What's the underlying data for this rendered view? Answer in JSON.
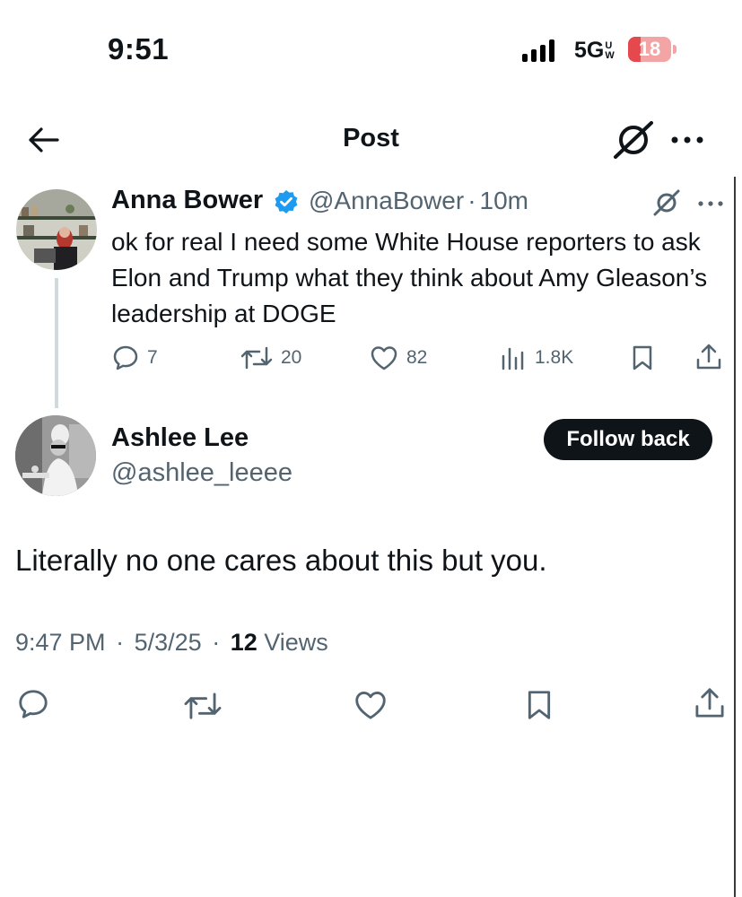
{
  "status_bar": {
    "time": "9:51",
    "network": "5G",
    "network_sup": "U",
    "network_sub": "W",
    "battery": "18",
    "battery_color": "#e5484d"
  },
  "header": {
    "title": "Post",
    "back_icon": "arrow-left-icon",
    "grok_icon": "grok-icon",
    "more_icon": "more-horizontal-icon"
  },
  "parent_post": {
    "author_name": "Anna Bower",
    "verified": true,
    "handle": "@AnnaBower",
    "separator": "·",
    "time_ago": "10m",
    "text": "ok for real I need some White House reporters to ask Elon and Trump what they think about Amy Gleason’s leadership at DOGE",
    "replies": "7",
    "reposts": "20",
    "likes": "82",
    "views": "1.8K"
  },
  "reply": {
    "author_name": "Ashlee Lee",
    "handle": "@ashlee_leeee",
    "follow_label": "Follow back",
    "text": "Literally no one cares about this but you.",
    "time": "9:47 PM",
    "date": "5/3/25",
    "separator": "·",
    "views_count": "12",
    "views_label": "Views"
  },
  "colors": {
    "text": "#0f1419",
    "secondary": "#536471",
    "verified": "#1d9bf0",
    "button_bg": "#0f1419"
  }
}
